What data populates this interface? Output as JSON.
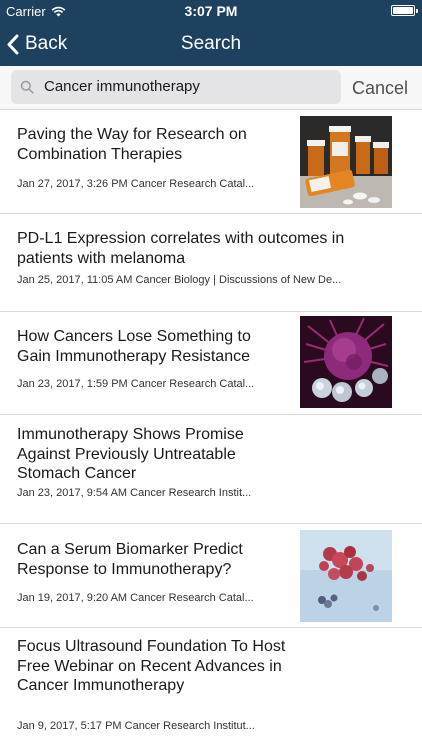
{
  "status": {
    "carrier": "Carrier",
    "time": "3:07 PM"
  },
  "nav": {
    "back_label": "Back",
    "title": "Search"
  },
  "search": {
    "query": "Cancer immunotherapy",
    "cancel_label": "Cancel"
  },
  "results": [
    {
      "title": "Paving the Way for Research on Combination Therapies",
      "meta": "Jan 27, 2017, 3:26 PM Cancer Research Catal...",
      "thumbnail": "pill-bottles-image"
    },
    {
      "title": "PD-L1 Expression correlates with outcomes in patients with melanoma",
      "meta": "Jan 25, 2017, 11:05 AM Cancer Biology | Discussions of New De...",
      "thumbnail": null
    },
    {
      "title": "How Cancers Lose Something to Gain Immunotherapy Resistance",
      "meta": "Jan 23, 2017, 1:59 PM Cancer Research Catal...",
      "thumbnail": "cancer-cell-image"
    },
    {
      "title": "Immunotherapy Shows Promise Against Previously Untreatable Stomach Cancer",
      "meta": "Jan 23, 2017, 9:54 AM Cancer Research Instit...",
      "thumbnail": null
    },
    {
      "title": "Can a Serum Biomarker Predict Response to Immunotherapy?",
      "meta": "Jan 19, 2017, 9:20 AM Cancer Research Catal...",
      "thumbnail": "biomarker-molecule-image"
    },
    {
      "title": "Focus Ultrasound Foundation To Host Free Webinar on Recent Advances in Cancer Immunotherapy",
      "meta": "Jan 9, 2017, 5:17 PM Cancer Research Institut...",
      "thumbnail": null
    }
  ],
  "colors": {
    "nav_background": "#1f4160",
    "search_field": "#e4e4e6"
  }
}
